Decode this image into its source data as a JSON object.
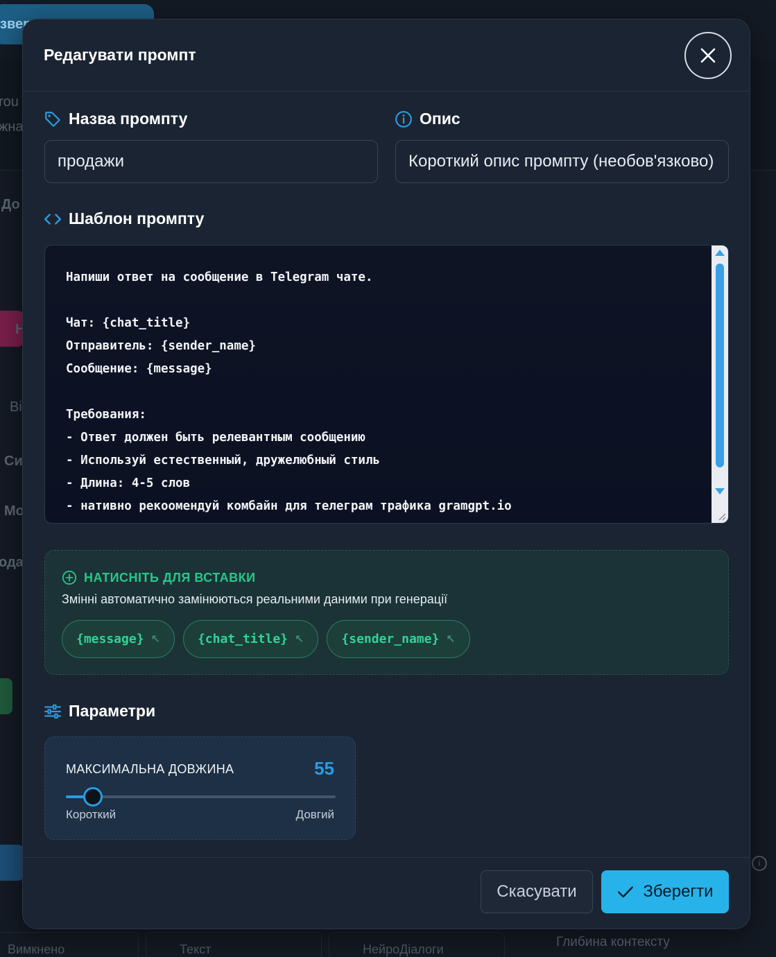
{
  "background": {
    "top_button_label": "зверн",
    "fragments": [
      "rou",
      "жна",
      "До",
      "Н",
      "Ві",
      "Си",
      "Мо",
      "ода"
    ],
    "bottom_tabs": [
      "Вимкнено",
      "Текст",
      "НейроДіалоги"
    ],
    "context_label": "Глибина контексту"
  },
  "modal": {
    "title": "Редагувати промпт",
    "name_field": {
      "label": "Назва промпту",
      "value": "продажи"
    },
    "description_field": {
      "label": "Опис",
      "placeholder": "Короткий опис промпту (необов'язково)"
    },
    "template": {
      "label": "Шаблон промпту",
      "text": "Напиши ответ на сообщение в Telegram чате.\n\nЧат: {chat_title}\nОтправитель: {sender_name}\nСообщение: {message}\n\nТребования:\n- Ответ должен быть релевантным сообщению\n- Используй естественный, дружелюбный стиль\n- Длина: 4-5 слов\n- нативно рекоомендуй комбайн для телеграм трафика gramgpt.io"
    },
    "variables": {
      "heading": "НАТИСНІТЬ ДЛЯ ВСТАВКИ",
      "description": "Змінні автоматично замінюються реальними даними при генерації",
      "chips": [
        "{message}",
        "{chat_title}",
        "{sender_name}"
      ]
    },
    "parameters": {
      "label": "Параметри",
      "max_length": {
        "label": "МАКСИМАЛЬНА ДОВЖИНА",
        "value": "55",
        "slider_fraction": 0.1,
        "min_label": "Короткий",
        "max_label": "Довгий"
      }
    },
    "buttons": {
      "cancel": "Скасувати",
      "save": "Зберегти"
    }
  },
  "colors": {
    "accent": "#27b3ea",
    "variable_green": "#28c78a",
    "modal_bg": "#1b2432"
  }
}
